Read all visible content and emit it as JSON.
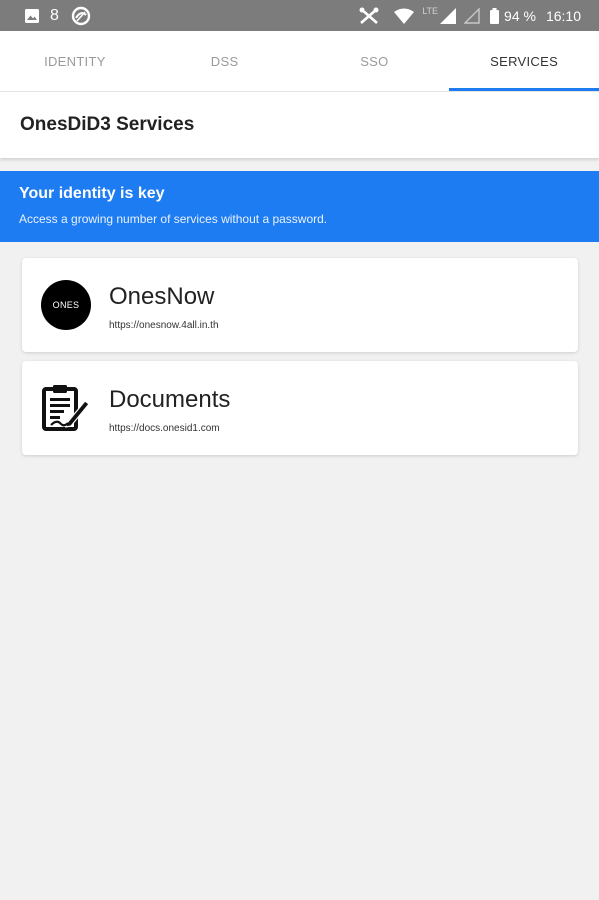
{
  "status_bar": {
    "notification_count": "8",
    "network": "LTE",
    "battery": "94 %",
    "time": "16:10"
  },
  "tabs": [
    {
      "label": "IDENTITY",
      "active": false
    },
    {
      "label": "DSS",
      "active": false
    },
    {
      "label": "SSO",
      "active": false
    },
    {
      "label": "SERVICES",
      "active": true
    }
  ],
  "header": {
    "title": "OnesDiD3 Services"
  },
  "banner": {
    "title": "Your identity is key",
    "subtitle": "Access a growing number of services without a password."
  },
  "services": [
    {
      "name": "OnesNow",
      "url": "https://onesnow.4all.in.th",
      "logo_text": "ONES",
      "icon": "ones-logo"
    },
    {
      "name": "Documents",
      "url": "https://docs.onesid1.com",
      "icon": "document-sign-icon"
    }
  ],
  "colors": {
    "accent": "#1e7cf2",
    "status_bar": "#7c7c7c",
    "background": "#f1f1f1"
  }
}
